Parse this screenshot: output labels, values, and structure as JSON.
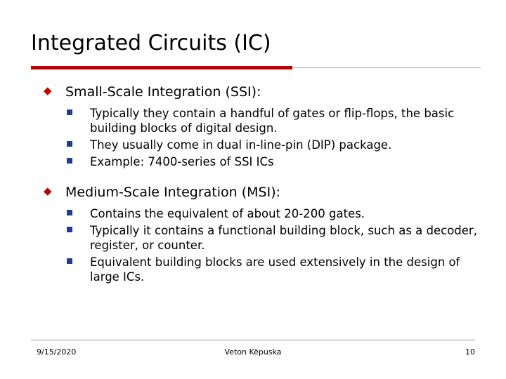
{
  "slide": {
    "title": "Integrated Circuits (IC)",
    "accent_color": "#c00000",
    "sub_bullet_color": "#1f3e8c",
    "sections": [
      {
        "heading": "Small-Scale Integration (SSI):",
        "items": [
          "Typically they contain a handful of gates or flip-flops, the basic building blocks of digital design.",
          "They usually come in dual in-line-pin (DIP) package.",
          "Example: 7400-series of SSI ICs"
        ]
      },
      {
        "heading": "Medium-Scale Integration (MSI):",
        "items": [
          "Contains the equivalent of about 20-200 gates.",
          "Typically it contains a functional building block, such as a decoder, register, or counter.",
          "Equivalent building blocks are used extensively in the design of large ICs."
        ]
      }
    ],
    "footer": {
      "date": "9/15/2020",
      "author": "Veton Këpuska",
      "page": "10"
    }
  }
}
